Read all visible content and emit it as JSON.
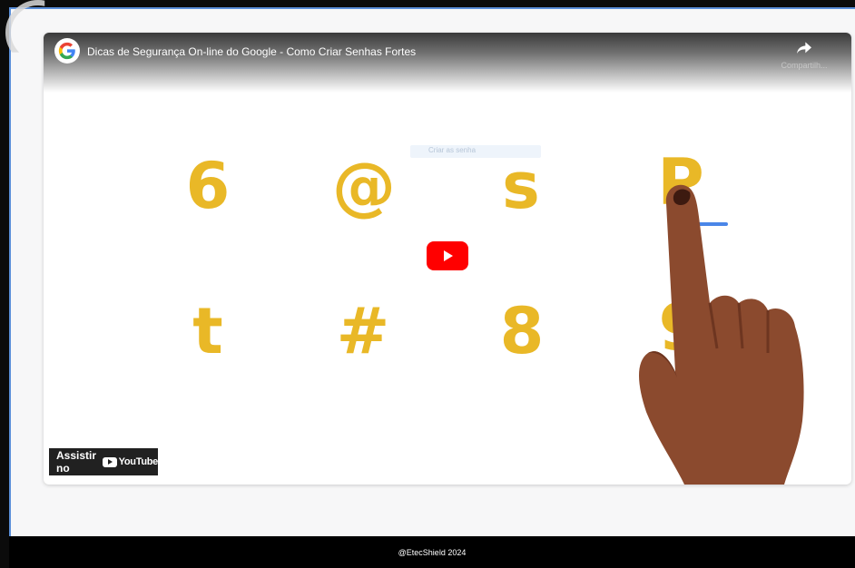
{
  "video": {
    "title": "Dicas de Segurança On-line do Google - Como Criar Senhas Fortes",
    "share_label": "Compartilh...",
    "search_ghost_text": "Criar as senha",
    "watch_on_label": "Assistir no",
    "youtube_brand": "YouTube",
    "characters_row1": [
      "6",
      "@",
      "s",
      "P"
    ],
    "characters_row2": [
      "t",
      "#",
      "8",
      "9"
    ],
    "accent_color": "#e9b827",
    "play_button_color": "#ff0000"
  },
  "footer": {
    "text": "@EtecShield 2024"
  }
}
